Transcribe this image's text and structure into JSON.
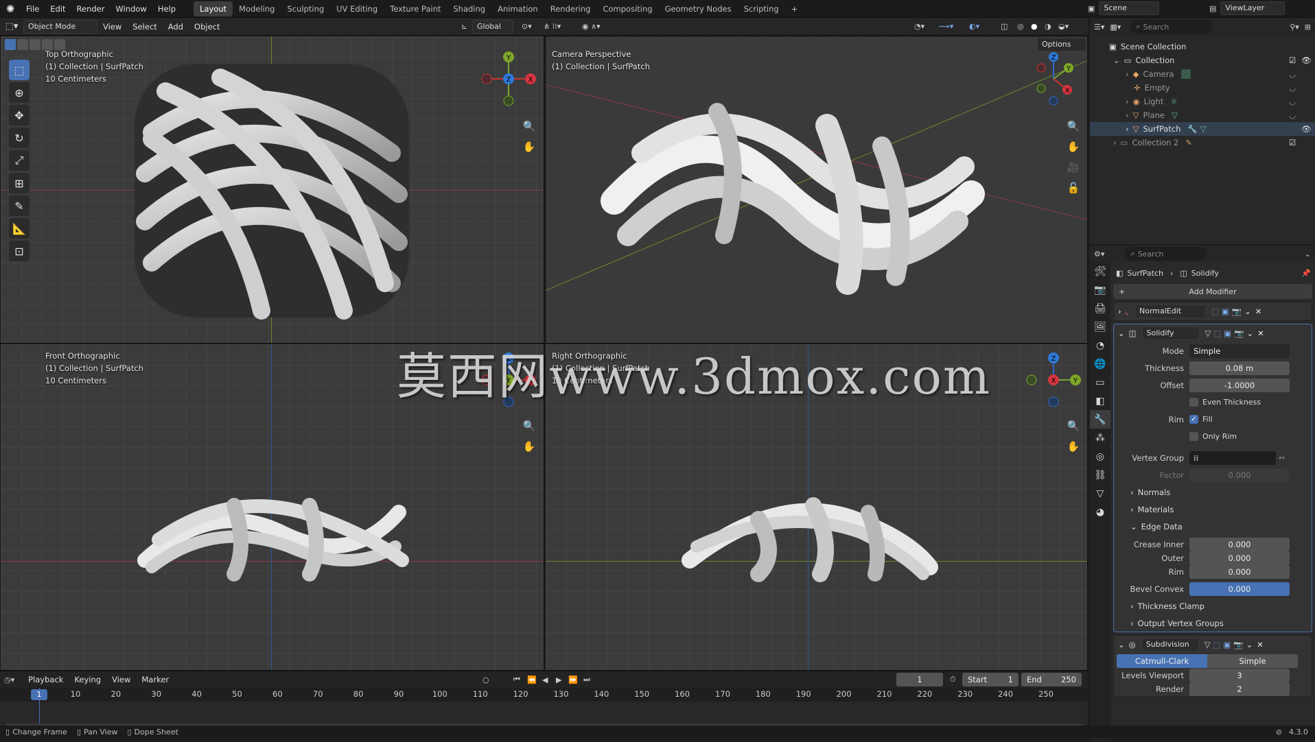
{
  "topbar": {
    "menus": [
      "File",
      "Edit",
      "Render",
      "Window",
      "Help"
    ],
    "workspaces": [
      "Layout",
      "Modeling",
      "Sculpting",
      "UV Editing",
      "Texture Paint",
      "Shading",
      "Animation",
      "Rendering",
      "Compositing",
      "Geometry Nodes",
      "Scripting"
    ],
    "active_workspace": "Layout",
    "add_tab": "+",
    "scene": "Scene",
    "view_layer": "ViewLayer"
  },
  "viewport_header": {
    "mode": "Object Mode",
    "menus": [
      "View",
      "Select",
      "Add",
      "Object"
    ],
    "transform_orientation": "Global",
    "options": "Options"
  },
  "viewports": {
    "top": {
      "line1": "Top Orthographic",
      "line2": "(1) Collection | SurfPatch",
      "line3": "10 Centimeters"
    },
    "camera": {
      "line1": "Camera Perspective",
      "line2": "(1) Collection | SurfPatch"
    },
    "front": {
      "line1": "Front Orthographic",
      "line2": "(1) Collection | SurfPatch",
      "line3": "10 Centimeters"
    },
    "right": {
      "line1": "Right Orthographic",
      "line2": "(1) Collection | SurfPatch",
      "line3": "10 Centimeters"
    }
  },
  "gizmo_axes": {
    "x": "X",
    "y": "Y",
    "z": "Z"
  },
  "watermark": "莫西网www.3dmox.com",
  "outliner": {
    "search_placeholder": "Search",
    "root": "Scene Collection",
    "collection": "Collection",
    "items": [
      "Camera",
      "Empty",
      "Light",
      "Plane",
      "SurfPatch"
    ],
    "collection2": "Collection 2"
  },
  "properties": {
    "search_placeholder": "Search",
    "breadcrumb_object": "SurfPatch",
    "breadcrumb_modifier": "Solidify",
    "add_modifier": "Add Modifier",
    "normaledit": {
      "name": "NormalEdit"
    },
    "solidify": {
      "name": "Solidify",
      "mode_label": "Mode",
      "mode_value": "Simple",
      "thickness_label": "Thickness",
      "thickness_value": "0.08 m",
      "offset_label": "Offset",
      "offset_value": "-1.0000",
      "even_thickness": "Even Thickness",
      "rim_label": "Rim",
      "fill": "Fill",
      "only_rim": "Only Rim",
      "vertex_group_label": "Vertex Group",
      "factor_label": "Factor",
      "factor_value": "0.000",
      "normals": "Normals",
      "materials": "Materials",
      "edge_data": "Edge Data",
      "crease_inner_label": "Crease Inner",
      "crease_inner_value": "0.000",
      "outer_label": "Outer",
      "outer_value": "0.000",
      "rim2_label": "Rim",
      "rim2_value": "0.000",
      "bevel_convex_label": "Bevel Convex",
      "bevel_convex_value": "0.000",
      "thickness_clamp": "Thickness Clamp",
      "output_vertex_groups": "Output Vertex Groups"
    },
    "subdivision": {
      "name": "Subdivision",
      "catmull": "Catmull-Clark",
      "simple": "Simple",
      "levels_label": "Levels Viewport",
      "levels_value": "3",
      "render_label": "Render",
      "render_value": "2"
    }
  },
  "timeline": {
    "menus": [
      "Playback",
      "Keying",
      "View",
      "Marker"
    ],
    "current_frame": "1",
    "start_label": "Start",
    "start_value": "1",
    "end_label": "End",
    "end_value": "250",
    "ticks": [
      "1",
      "10",
      "20",
      "30",
      "40",
      "50",
      "60",
      "70",
      "80",
      "90",
      "100",
      "110",
      "120",
      "130",
      "140",
      "150",
      "160",
      "170",
      "180",
      "190",
      "200",
      "210",
      "220",
      "230",
      "240",
      "250"
    ]
  },
  "statusbar": {
    "change_frame": "Change Frame",
    "pan_view": "Pan View",
    "dope_sheet": "Dope Sheet",
    "version": "4.3.0"
  }
}
